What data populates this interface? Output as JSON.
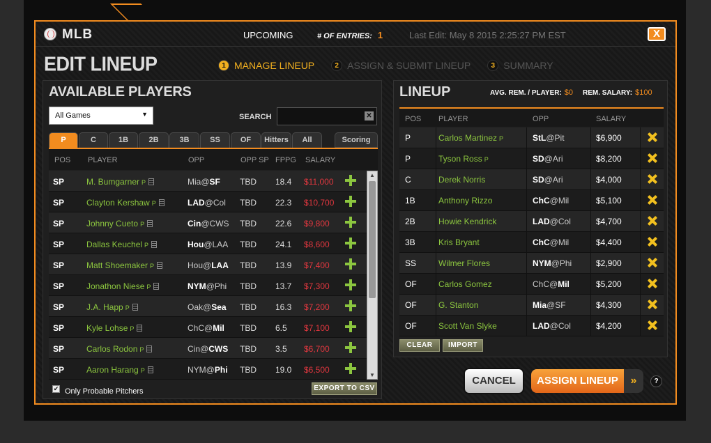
{
  "header": {
    "sport": "MLB",
    "upcoming": "UPCOMING",
    "entries_label": "# OF ENTRIES:",
    "entries_value": "1",
    "last_edit": "Last Edit: May 8 2015 2:25:27 PM EST",
    "close": "X"
  },
  "page_title": "EDIT LINEUP",
  "steps": [
    {
      "num": "1",
      "label": "MANAGE LINEUP"
    },
    {
      "num": "2",
      "label": "ASSIGN & SUBMIT LINEUP"
    },
    {
      "num": "3",
      "label": "SUMMARY"
    }
  ],
  "available": {
    "title": "AVAILABLE PLAYERS",
    "games_select": "All Games",
    "search_label": "SEARCH",
    "search_value": "",
    "tabs": [
      "P",
      "C",
      "1B",
      "2B",
      "3B",
      "SS",
      "OF",
      "Hitters",
      "All"
    ],
    "scoring": "Scoring",
    "columns": [
      "POS",
      "PLAYER",
      "OPP",
      "OPP SP",
      "FPPG",
      "SALARY"
    ],
    "players": [
      {
        "pos": "SP",
        "name": "M. Bumgarner",
        "tag": "P",
        "opp_a": "Mia",
        "opp_at": "@",
        "opp_b": "SF",
        "home_bold": "b",
        "opp_sp": "TBD",
        "fppg": "18.4",
        "salary": "$11,000"
      },
      {
        "pos": "SP",
        "name": "Clayton Kershaw",
        "tag": "P",
        "opp_a": "LAD",
        "opp_at": "@",
        "opp_b": "Col",
        "home_bold": "a",
        "opp_sp": "TBD",
        "fppg": "22.3",
        "salary": "$10,700"
      },
      {
        "pos": "SP",
        "name": "Johnny Cueto",
        "tag": "P",
        "opp_a": "Cin",
        "opp_at": "@",
        "opp_b": "CWS",
        "home_bold": "a",
        "opp_sp": "TBD",
        "fppg": "22.6",
        "salary": "$9,800"
      },
      {
        "pos": "SP",
        "name": "Dallas Keuchel",
        "tag": "P",
        "opp_a": "Hou",
        "opp_at": "@",
        "opp_b": "LAA",
        "home_bold": "a",
        "opp_sp": "TBD",
        "fppg": "24.1",
        "salary": "$8,600"
      },
      {
        "pos": "SP",
        "name": "Matt Shoemaker",
        "tag": "P",
        "opp_a": "Hou",
        "opp_at": "@",
        "opp_b": "LAA",
        "home_bold": "b",
        "opp_sp": "TBD",
        "fppg": "13.9",
        "salary": "$7,400"
      },
      {
        "pos": "SP",
        "name": "Jonathon Niese",
        "tag": "P",
        "opp_a": "NYM",
        "opp_at": "@",
        "opp_b": "Phi",
        "home_bold": "a",
        "opp_sp": "TBD",
        "fppg": "13.7",
        "salary": "$7,300"
      },
      {
        "pos": "SP",
        "name": "J.A. Happ",
        "tag": "P",
        "opp_a": "Oak",
        "opp_at": "@",
        "opp_b": "Sea",
        "home_bold": "b",
        "opp_sp": "TBD",
        "fppg": "16.3",
        "salary": "$7,200"
      },
      {
        "pos": "SP",
        "name": "Kyle Lohse",
        "tag": "P",
        "opp_a": "ChC",
        "opp_at": "@",
        "opp_b": "Mil",
        "home_bold": "b",
        "opp_sp": "TBD",
        "fppg": "6.5",
        "salary": "$7,100"
      },
      {
        "pos": "SP",
        "name": "Carlos Rodon",
        "tag": "P",
        "opp_a": "Cin",
        "opp_at": "@",
        "opp_b": "CWS",
        "home_bold": "b",
        "opp_sp": "TBD",
        "fppg": "3.5",
        "salary": "$6,700"
      },
      {
        "pos": "SP",
        "name": "Aaron Harang",
        "tag": "P",
        "opp_a": "NYM",
        "opp_at": "@",
        "opp_b": "Phi",
        "home_bold": "b",
        "opp_sp": "TBD",
        "fppg": "19.0",
        "salary": "$6,500"
      }
    ],
    "only_probable": "Only Probable Pitchers",
    "only_probable_checked": true,
    "export": "EXPORT TO CSV"
  },
  "lineup": {
    "title": "LINEUP",
    "avg_rem_label": "AVG. REM. / PLAYER:",
    "avg_rem_value": "$0",
    "rem_salary_label": "REM. SALARY:",
    "rem_salary_value": "$100",
    "columns": [
      "POS",
      "PLAYER",
      "OPP",
      "SALARY"
    ],
    "players": [
      {
        "pos": "P",
        "name": "Carlos Martinez",
        "tag": "P",
        "opp_a": "StL",
        "opp_at": "@",
        "opp_b": "Pit",
        "home_bold": "a",
        "salary": "$6,900"
      },
      {
        "pos": "P",
        "name": "Tyson Ross",
        "tag": "P",
        "opp_a": "SD",
        "opp_at": "@",
        "opp_b": "Ari",
        "home_bold": "a",
        "salary": "$8,200"
      },
      {
        "pos": "C",
        "name": "Derek Norris",
        "tag": "",
        "opp_a": "SD",
        "opp_at": "@",
        "opp_b": "Ari",
        "home_bold": "a",
        "salary": "$4,000"
      },
      {
        "pos": "1B",
        "name": "Anthony Rizzo",
        "tag": "",
        "opp_a": "ChC",
        "opp_at": "@",
        "opp_b": "Mil",
        "home_bold": "a",
        "salary": "$5,100"
      },
      {
        "pos": "2B",
        "name": "Howie Kendrick",
        "tag": "",
        "opp_a": "LAD",
        "opp_at": "@",
        "opp_b": "Col",
        "home_bold": "a",
        "salary": "$4,700"
      },
      {
        "pos": "3B",
        "name": "Kris Bryant",
        "tag": "",
        "opp_a": "ChC",
        "opp_at": "@",
        "opp_b": "Mil",
        "home_bold": "a",
        "salary": "$4,400"
      },
      {
        "pos": "SS",
        "name": "Wilmer Flores",
        "tag": "",
        "opp_a": "NYM",
        "opp_at": "@",
        "opp_b": "Phi",
        "home_bold": "a",
        "salary": "$2,900"
      },
      {
        "pos": "OF",
        "name": "Carlos Gomez",
        "tag": "",
        "opp_a": "ChC",
        "opp_at": "@",
        "opp_b": "Mil",
        "home_bold": "b",
        "salary": "$5,200"
      },
      {
        "pos": "OF",
        "name": "G. Stanton",
        "tag": "",
        "opp_a": "Mia",
        "opp_at": "@",
        "opp_b": "SF",
        "home_bold": "a",
        "salary": "$4,300"
      },
      {
        "pos": "OF",
        "name": "Scott Van Slyke",
        "tag": "",
        "opp_a": "LAD",
        "opp_at": "@",
        "opp_b": "Col",
        "home_bold": "a",
        "salary": "$4,200"
      }
    ],
    "clear": "CLEAR",
    "import": "IMPORT"
  },
  "actions": {
    "cancel": "CANCEL",
    "assign": "ASSIGN LINEUP",
    "assign_arrow": "»",
    "help": "?"
  },
  "colors": {
    "accent": "#f28c1f",
    "player_name": "#8cc63f",
    "salary": "#e2373f",
    "remove": "#f2c01f"
  },
  "icons": {
    "logo": "baseball-icon",
    "remove": "x-remove-icon",
    "add": "plus-add-icon",
    "doc": "news-doc-icon"
  }
}
